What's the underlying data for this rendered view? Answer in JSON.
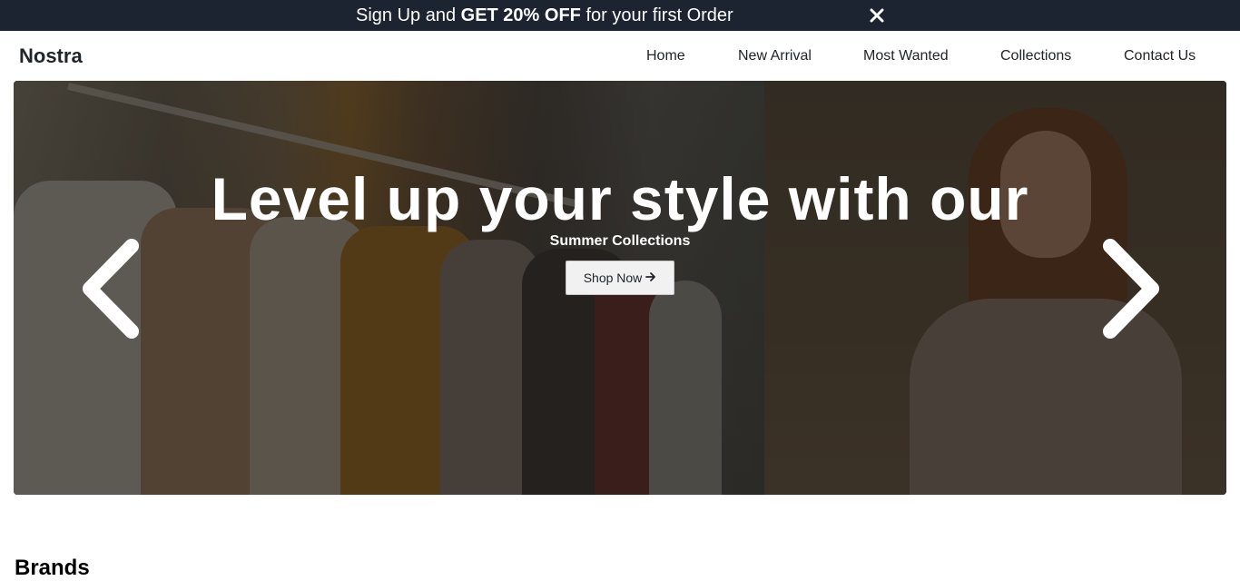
{
  "announcement": {
    "prefix": "Sign Up and ",
    "highlight": "GET 20% OFF",
    "suffix": " for your first Order",
    "close_icon": "close-icon",
    "bg_color": "#1c2331"
  },
  "nav": {
    "brand": "Nostra",
    "links": [
      "Home",
      "New Arrival",
      "Most Wanted",
      "Collections",
      "Contact Us"
    ]
  },
  "hero": {
    "title": "Level up your style with our",
    "subtitle": "Summer Collections",
    "button_label": "Shop Now",
    "button_icon": "arrow-right-icon",
    "prev_icon": "chevron-left-icon",
    "next_icon": "chevron-right-icon"
  },
  "brands": {
    "heading": "Brands"
  }
}
